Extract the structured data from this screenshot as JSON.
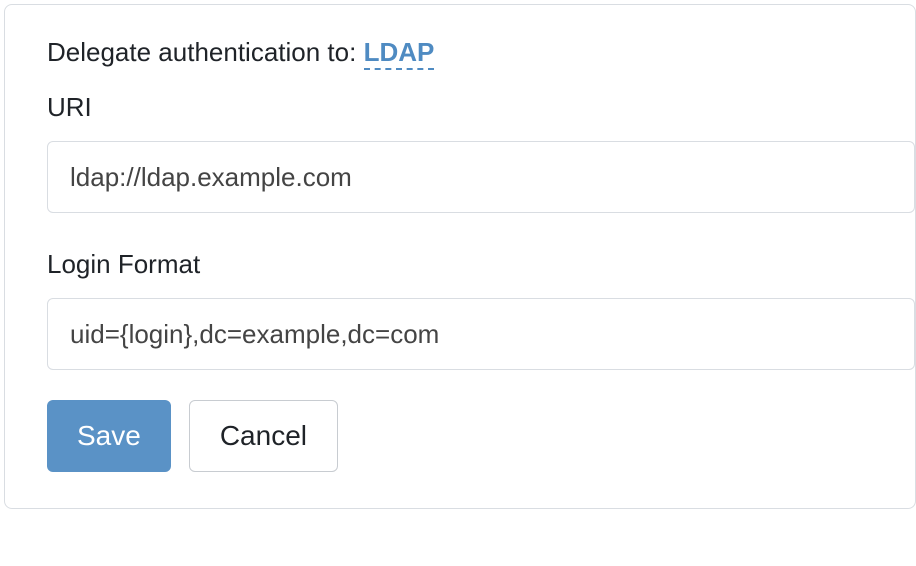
{
  "header": {
    "delegate_prefix": "Delegate authentication to: ",
    "delegate_target": "LDAP"
  },
  "fields": {
    "uri": {
      "label": "URI",
      "value": "ldap://ldap.example.com"
    },
    "login_format": {
      "label": "Login Format",
      "value": "uid={login},dc=example,dc=com"
    }
  },
  "buttons": {
    "save": "Save",
    "cancel": "Cancel"
  }
}
